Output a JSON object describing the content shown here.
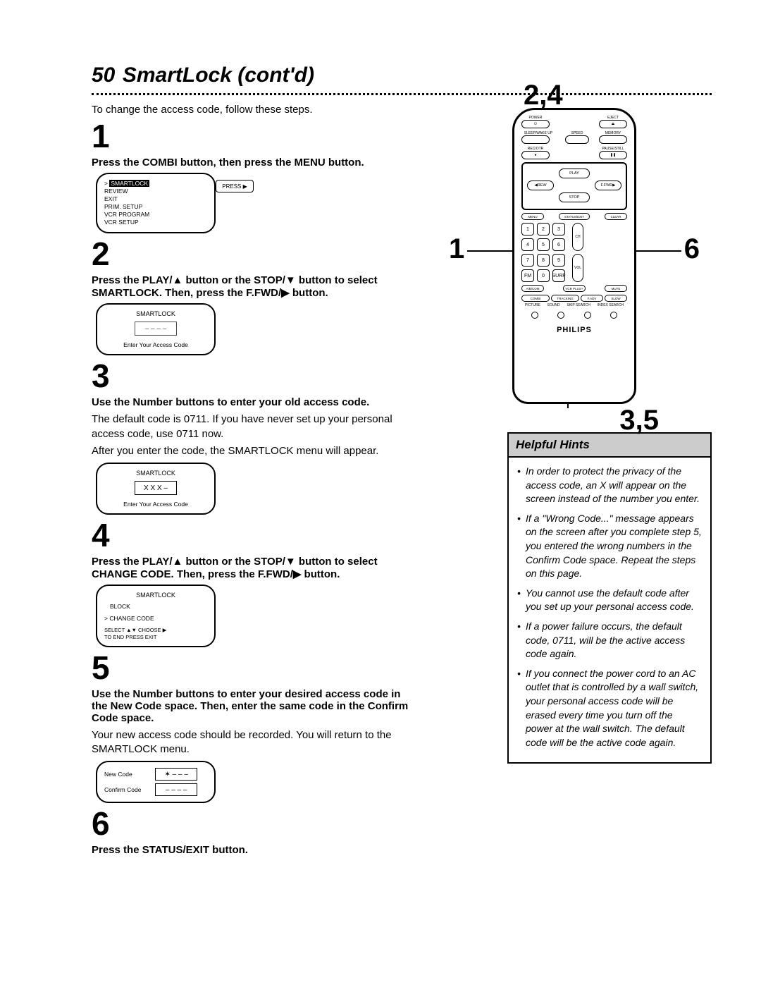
{
  "page": {
    "number": "50",
    "title": "SmartLock (cont'd)"
  },
  "intro": "To change the access code, follow these steps.",
  "steps": {
    "s1": {
      "num": "1",
      "head": "Press the COMBI button, then press the MENU button."
    },
    "s2": {
      "num": "2",
      "head": "Press the PLAY/▲ button or the STOP/▼ button to select SMARTLOCK. Then, press the F.FWD/▶ button."
    },
    "s3": {
      "num": "3",
      "head": "Use the Number buttons to enter your old access code.",
      "body1": "The default code is 0711. If you have never set up your personal access code, use 0711 now.",
      "body2": "After you enter the code, the SMARTLOCK menu will appear."
    },
    "s4": {
      "num": "4",
      "head": "Press the PLAY/▲ button or the STOP/▼ button to select CHANGE CODE. Then, press the F.FWD/▶ button."
    },
    "s5": {
      "num": "5",
      "head": "Use the Number buttons to enter your desired access code in the New Code space. Then, enter the same code in the Confirm Code space.",
      "body": "Your new access code should be recorded. You will return to the SMARTLOCK menu."
    },
    "s6": {
      "num": "6",
      "head": "Press the STATUS/EXIT button."
    }
  },
  "screen1": {
    "menu": [
      "SMARTLOCK",
      "REVIEW",
      "EXIT",
      "PRIM. SETUP",
      "VCR PROGRAM",
      "VCR SETUP"
    ],
    "press": "PRESS ▶"
  },
  "screen2": {
    "title": "SMARTLOCK",
    "sub": "Enter Your Access Code",
    "code": "– – – –"
  },
  "screen3": {
    "title": "SMARTLOCK",
    "sub": "Enter Your Access Code",
    "code": "X  X  X –"
  },
  "screen4": {
    "title": "SMARTLOCK",
    "block": "BLOCK",
    "change": "> CHANGE CODE",
    "fine1": "SELECT ▲▼ CHOOSE ▶",
    "fine2": "TO END PRESS EXIT"
  },
  "screen5": {
    "new": "New Code",
    "confirm": "Confirm Code",
    "dash": "– – – –"
  },
  "remote": {
    "labels": {
      "power": "POWER",
      "eject": "EJECT",
      "sleep": "SLEEP/WAKE UP",
      "speed": "SPEED",
      "memory": "MEMORY",
      "recotr": "REC/OTR",
      "pause": "PAUSE/STILL",
      "play": "PLAY",
      "rew": "REW",
      "ffwd": "F.FWD",
      "stop": "STOP",
      "menu": "MENU",
      "status": "STATUS/EXIT",
      "clear": "CLEAR",
      "ch": "CH",
      "vol": "VOL",
      "fm": "FM",
      "surf": "SURF",
      "abcom": "A/B/COM",
      "vcrplus": "VCR PLUS+",
      "combi": "COMBI",
      "tracking": "TRACKING",
      "fadv": "F.ADV",
      "slow": "SLOW",
      "mute": "MUTE",
      "picture": "PICTURE",
      "sound": "SOUND",
      "skip": "SKIP SEARCH",
      "index": "INDEX SEARCH"
    },
    "num": [
      "1",
      "2",
      "3",
      "4",
      "5",
      "6",
      "7",
      "8",
      "9",
      "0"
    ],
    "brand": "PHILIPS"
  },
  "callouts": {
    "c24": "2,4",
    "c1": "1",
    "c6": "6",
    "c35": "3,5"
  },
  "hints": {
    "title": "Helpful Hints",
    "items": [
      "In order to protect the privacy of the access code, an X will appear on the screen instead of the number you enter.",
      "If a \"Wrong Code...\" message appears on the screen after you complete step 5, you entered the wrong numbers in the Confirm Code space. Repeat the steps on this page.",
      "You cannot use the default code after you set up your personal access code.",
      "If a power failure occurs, the default code, 0711, will be the active access code again.",
      "If you connect the power cord to an AC outlet that is controlled by a wall switch, your personal access code will be erased every time you turn off the power at the wall switch. The default code will be the active code again."
    ]
  }
}
